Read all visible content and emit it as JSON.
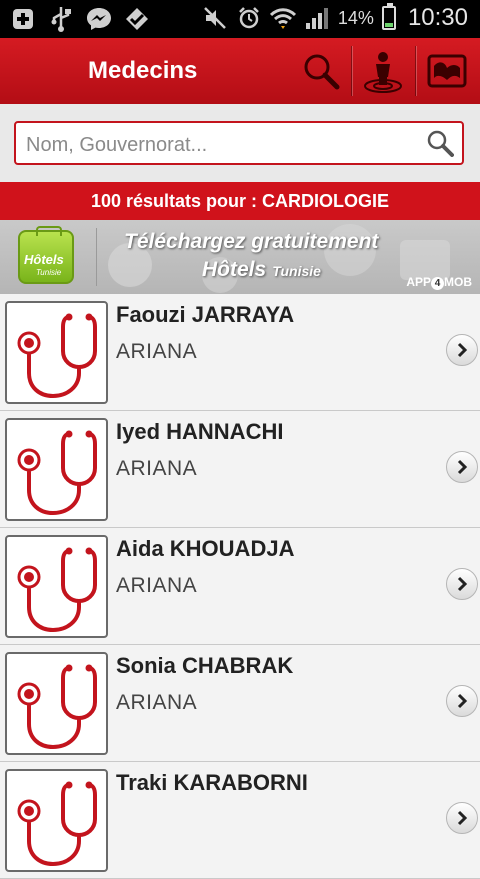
{
  "status_bar": {
    "battery": "14%",
    "time": "10:30",
    "icons": [
      "plus-icon",
      "usb-icon",
      "messenger-icon",
      "check-icon",
      "mute-icon",
      "alarm-icon",
      "wifi-icon",
      "signal-icon",
      "battery-icon"
    ]
  },
  "appbar": {
    "title": "Medecins",
    "actions": [
      "search-icon",
      "location-icon",
      "map-icon"
    ]
  },
  "search": {
    "placeholder": "Nom, Gouvernorat...",
    "value": ""
  },
  "results": {
    "label": "100 résultats pour : CARDIOLOGIE"
  },
  "ad": {
    "logo_text": "Hôtels",
    "logo_sub": "Tunisie",
    "line1": "Téléchargez gratuitement",
    "line2": "Hôtels",
    "line2_small": "Tunisie",
    "brand_pre": "APP",
    "brand_four": "4",
    "brand_post": "MOB"
  },
  "doctors": [
    {
      "name": "Faouzi JARRAYA",
      "city": "ARIANA"
    },
    {
      "name": "Iyed HANNACHI",
      "city": "ARIANA"
    },
    {
      "name": "Aida KHOUADJA",
      "city": "ARIANA"
    },
    {
      "name": "Sonia CHABRAK",
      "city": "ARIANA"
    },
    {
      "name": "Traki KARABORNI",
      "city": ""
    }
  ],
  "colors": {
    "primary_red": "#d0121b",
    "stethoscope_red": "#c3141d"
  }
}
